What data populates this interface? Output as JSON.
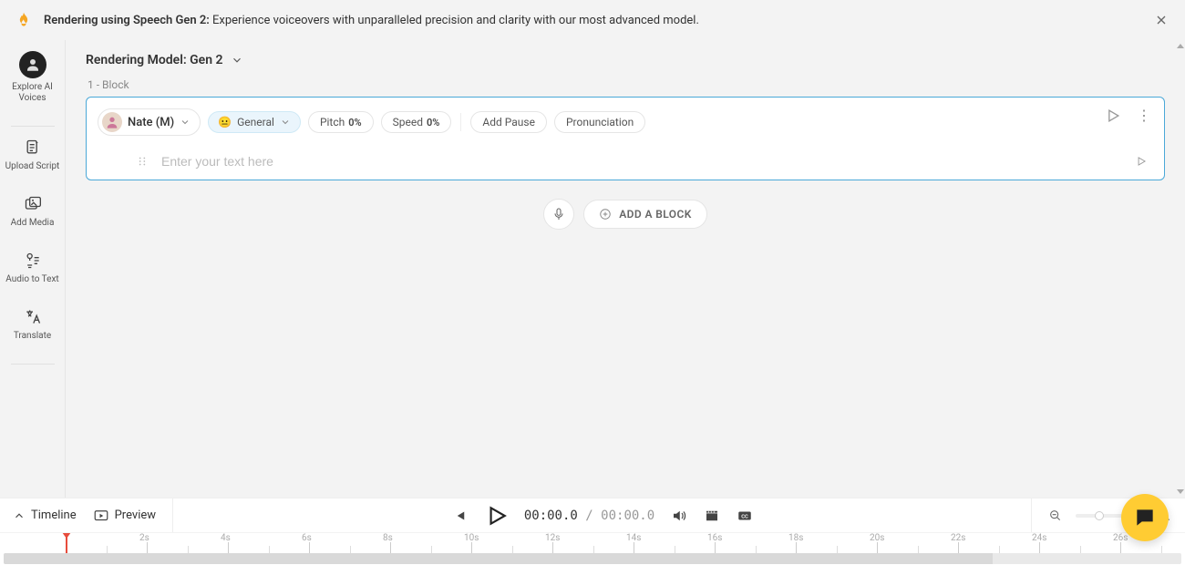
{
  "banner": {
    "bold": "Rendering using Speech Gen 2:",
    "rest": " Experience voiceovers with unparalleled precision and clarity with our most advanced model."
  },
  "sidebar": {
    "items": [
      {
        "label": "Explore AI Voices"
      },
      {
        "label": "Upload Script"
      },
      {
        "label": "Add Media"
      },
      {
        "label": "Audio to Text"
      },
      {
        "label": "Translate"
      }
    ]
  },
  "header": {
    "rendering_model_label": "Rendering Model: Gen 2"
  },
  "block": {
    "index_label": "1 -   Block",
    "voice_name": "Nate (M)",
    "tone_label": "General",
    "pitch_label": "Pitch",
    "pitch_value": "0%",
    "speed_label": "Speed",
    "speed_value": "0%",
    "add_pause_label": "Add Pause",
    "pronunciation_label": "Pronunciation",
    "text_placeholder": "Enter your text here"
  },
  "add": {
    "add_block_label": "ADD A BLOCK"
  },
  "controls": {
    "timeline_label": "Timeline",
    "preview_label": "Preview",
    "current_time": "00:00.0",
    "separator": " / ",
    "duration": "00:00.0"
  },
  "timeline": {
    "ticks": [
      "2s",
      "4s",
      "6s",
      "8s",
      "10s",
      "12s",
      "14s",
      "16s",
      "18s",
      "20s",
      "22s",
      "24s",
      "26s"
    ]
  }
}
